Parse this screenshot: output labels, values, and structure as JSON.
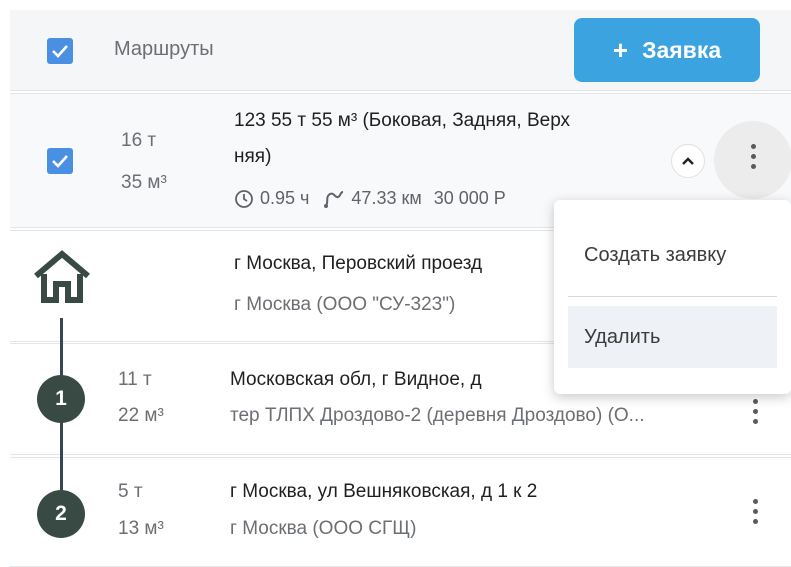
{
  "header": {
    "title": "Маршруты",
    "add_button_plus": "+",
    "add_button_label": "Заявка"
  },
  "route": {
    "weight": "16 т",
    "volume": "35 м³",
    "title_line1": "123 55 т 55 м³ (Боковая, Задняя, Верх",
    "title_line2": "няя)",
    "time": "0.95 ч",
    "distance": "47.33 км",
    "price": "30 000 Р"
  },
  "stops": [
    {
      "address": "г Москва, Перовский проезд",
      "company": "г Москва (ООО \"СУ-323\")"
    },
    {
      "number": "1",
      "weight": "11 т",
      "volume": "22 м³",
      "address": "Московская обл, г Видное, д",
      "company": "тер ТЛПХ Дроздово-2 (деревня Дроздово) (О..."
    },
    {
      "number": "2",
      "weight": "5 т",
      "volume": "13 м³",
      "address": "г Москва, ул Вешняковская, д 1 к 2",
      "company": "г Москва (ООО СГЩ)"
    }
  ],
  "menu": {
    "create": "Создать заявку",
    "delete": "Удалить"
  },
  "colors": {
    "accent": "#3aa3e0",
    "checkbox": "#4a90e2",
    "timeline": "#394a45"
  }
}
